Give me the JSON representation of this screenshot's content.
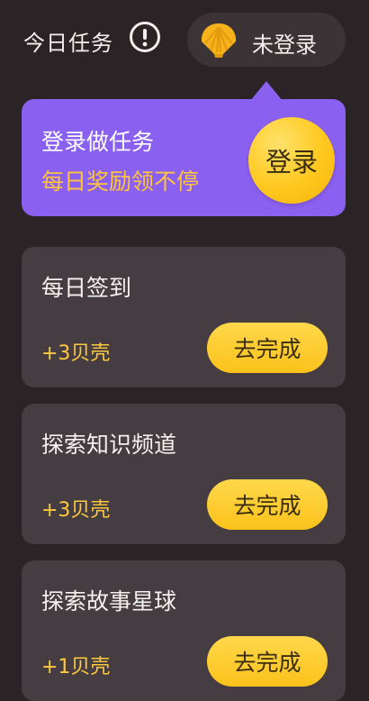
{
  "header": {
    "title": "今日任务",
    "login_label": "未登录"
  },
  "promo": {
    "title": "登录做任务",
    "subtitle": "每日奖励领不停",
    "button_label": "登录"
  },
  "tasks": [
    {
      "title": "每日签到",
      "reward": "+3贝壳",
      "button_label": "去完成"
    },
    {
      "title": "探索知识频道",
      "reward": "+3贝壳",
      "button_label": "去完成"
    },
    {
      "title": "探索故事星球",
      "reward": "+1贝壳",
      "button_label": "去完成"
    }
  ],
  "colors": {
    "background": "#2b2426",
    "promo": "#8a60f0",
    "accent_yellow": "#ffc83d",
    "card": "#453d41"
  },
  "icons": {
    "info": "exclamation-circle-icon",
    "shell": "shell-icon"
  }
}
